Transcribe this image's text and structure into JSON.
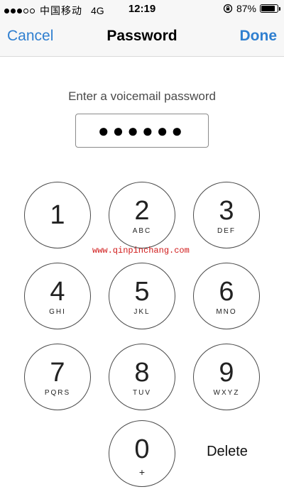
{
  "status_bar": {
    "carrier": "中国移动",
    "network": "4G",
    "time": "12:19",
    "battery_percent": "87%",
    "battery_level": 0.87,
    "signal_bars_filled": 3,
    "signal_bars_total": 5
  },
  "nav": {
    "cancel_label": "Cancel",
    "title": "Password",
    "done_label": "Done"
  },
  "prompt": "Enter a voicemail password",
  "password_mask": "●●●●●●",
  "keypad": {
    "keys": [
      {
        "digit": "1",
        "letters": ""
      },
      {
        "digit": "2",
        "letters": "ABC"
      },
      {
        "digit": "3",
        "letters": "DEF"
      },
      {
        "digit": "4",
        "letters": "GHI"
      },
      {
        "digit": "5",
        "letters": "JKL"
      },
      {
        "digit": "6",
        "letters": "MNO"
      },
      {
        "digit": "7",
        "letters": "PQRS"
      },
      {
        "digit": "8",
        "letters": "TUV"
      },
      {
        "digit": "9",
        "letters": "WXYZ"
      },
      {
        "digit": "0",
        "letters": "+"
      }
    ],
    "delete_label": "Delete"
  },
  "watermark": "www.qinpinchang.com",
  "colors": {
    "accent": "#2f7fd0",
    "watermark": "#d01818"
  },
  "icons": {
    "status_lock": "rotation-lock-icon",
    "battery": "battery-icon"
  }
}
